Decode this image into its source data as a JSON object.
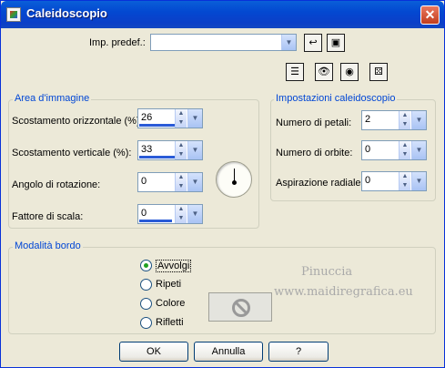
{
  "window": {
    "title": "Caleidoscopio",
    "close_glyph": "✕"
  },
  "presets": {
    "label": "Imp. predef.:",
    "value": ""
  },
  "toolbar_icons": [
    "reset-icon",
    "eye-preview-icon",
    "eye-proof-icon",
    "randomize-dice-icon"
  ],
  "area": {
    "title": "Area d'immagine",
    "fields": [
      {
        "label": "Scostamento orizzontale (%):",
        "value": "26"
      },
      {
        "label": "Scostamento verticale (%):",
        "value": "33"
      },
      {
        "label": "Angolo di rotazione:",
        "value": "0"
      },
      {
        "label": "Fattore di scala:",
        "value": "0"
      }
    ]
  },
  "settings": {
    "title": "Impostazioni caleidoscopio",
    "fields": [
      {
        "label": "Numero di petali:",
        "value": "2"
      },
      {
        "label": "Numero di orbite:",
        "value": "0"
      },
      {
        "label": "Aspirazione radiale:",
        "value": "0"
      }
    ]
  },
  "border_mode": {
    "title": "Modalità bordo",
    "options": [
      {
        "label": "Avvolgi",
        "selected": true
      },
      {
        "label": "Ripeti",
        "selected": false
      },
      {
        "label": "Colore",
        "selected": false
      },
      {
        "label": "Rifletti",
        "selected": false
      }
    ]
  },
  "watermark": {
    "line1": "Pinuccia",
    "line2": "www.maidiregrafica.eu"
  },
  "buttons": {
    "ok": "OK",
    "cancel": "Annulla",
    "help": "?"
  }
}
